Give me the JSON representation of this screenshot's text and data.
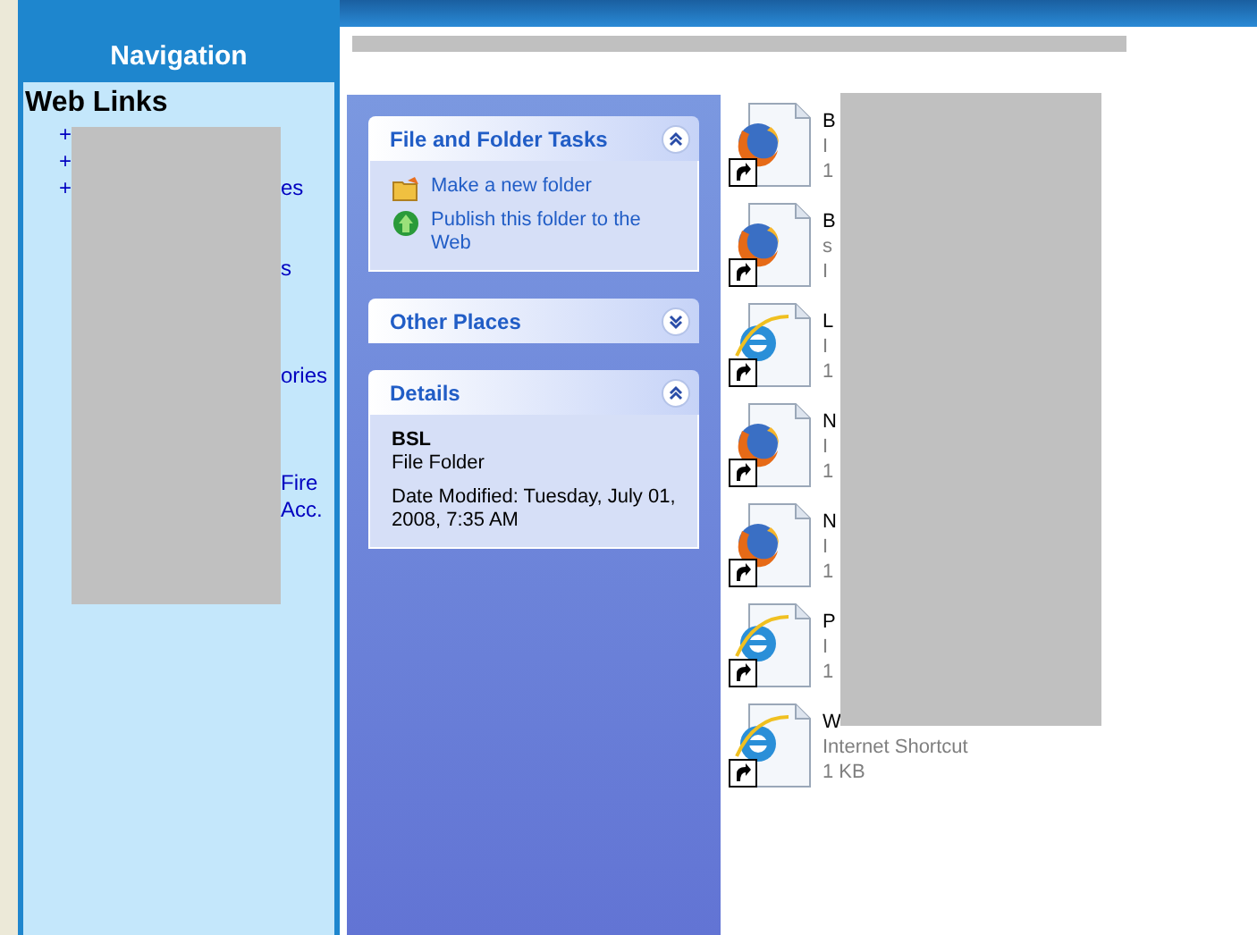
{
  "navigation": {
    "title": "Navigation",
    "heading": "Web Links",
    "links": [
      {
        "marker": "+"
      },
      {
        "marker": "+"
      },
      {
        "marker": "+",
        "text": "es"
      },
      {
        "text": "s"
      },
      {
        "text": "ories"
      },
      {
        "text": "Fire",
        "text2": "Acc."
      }
    ]
  },
  "task_pane": {
    "panels": [
      {
        "title": "File and Folder Tasks",
        "expanded": true,
        "kind": "tasks",
        "tasks": [
          {
            "label": "Make a new folder"
          },
          {
            "label": "Publish this folder to the Web"
          }
        ]
      },
      {
        "title": "Other Places",
        "expanded": false
      },
      {
        "title": "Details",
        "expanded": true,
        "kind": "details",
        "name": "BSL",
        "type": "File Folder",
        "modified": "Date Modified: Tuesday, July 01, 2008, 7:35 AM"
      }
    ]
  },
  "files": [
    {
      "kind": "firefox",
      "lines": [
        "B",
        "I",
        "1"
      ]
    },
    {
      "kind": "firefox",
      "lines": [
        "B",
        "s",
        "I"
      ]
    },
    {
      "kind": "ie",
      "lines": [
        "L",
        "I",
        "1"
      ]
    },
    {
      "kind": "firefox",
      "lines": [
        "N",
        "I",
        "1"
      ]
    },
    {
      "kind": "firefox",
      "lines": [
        "N",
        "I",
        "1"
      ]
    },
    {
      "kind": "ie",
      "lines": [
        "P",
        "I",
        "1"
      ]
    },
    {
      "kind": "ie",
      "lines": [
        "W",
        "Internet Shortcut",
        "1 KB"
      ]
    }
  ]
}
